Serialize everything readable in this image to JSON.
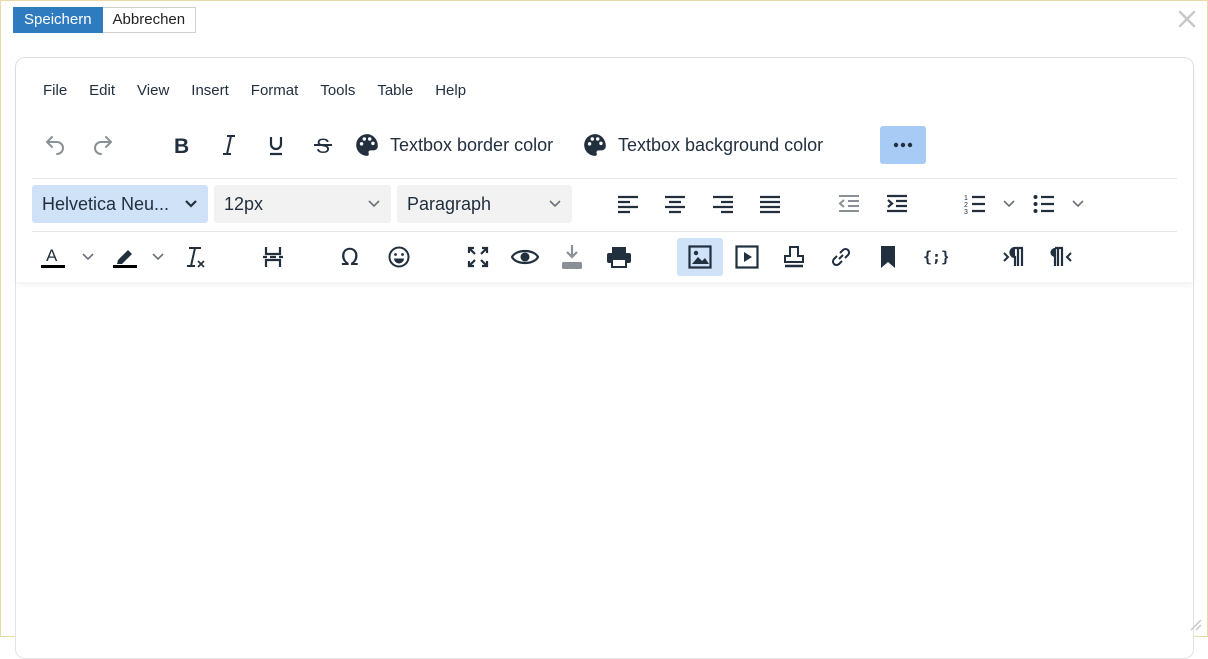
{
  "topbar": {
    "save_label": "Speichern",
    "cancel_label": "Abbrechen"
  },
  "menubar": {
    "items": [
      "File",
      "Edit",
      "View",
      "Insert",
      "Format",
      "Tools",
      "Table",
      "Help"
    ]
  },
  "toolbar": {
    "border_color_label": "Textbox border color",
    "background_color_label": "Textbox background color",
    "font_family": "Helvetica Neu...",
    "font_size": "12px",
    "block_format": "Paragraph"
  },
  "colors": {
    "primary": "#2f7bbf",
    "active_button": "#cfe2f7",
    "more_button": "#a7cbf5",
    "icon": "#222f3e",
    "text_color_bar": "#000000"
  },
  "icons": [
    "undo-icon",
    "redo-icon",
    "bold-icon",
    "italic-icon",
    "underline-icon",
    "strikethrough-icon",
    "palette-icon",
    "more-icon",
    "chevron-down-icon",
    "align-left-icon",
    "align-center-icon",
    "align-right-icon",
    "align-justify-icon",
    "outdent-icon",
    "indent-icon",
    "numbered-list-icon",
    "bullet-list-icon",
    "text-color-icon",
    "highlight-icon",
    "clear-formatting-icon",
    "page-break-icon",
    "omega-icon",
    "emoji-icon",
    "fullscreen-icon",
    "preview-icon",
    "download-icon",
    "print-icon",
    "image-icon",
    "media-icon",
    "stamp-icon",
    "link-icon",
    "bookmark-icon",
    "code-braces-icon",
    "ltr-icon",
    "rtl-icon",
    "close-icon",
    "resize-icon"
  ]
}
